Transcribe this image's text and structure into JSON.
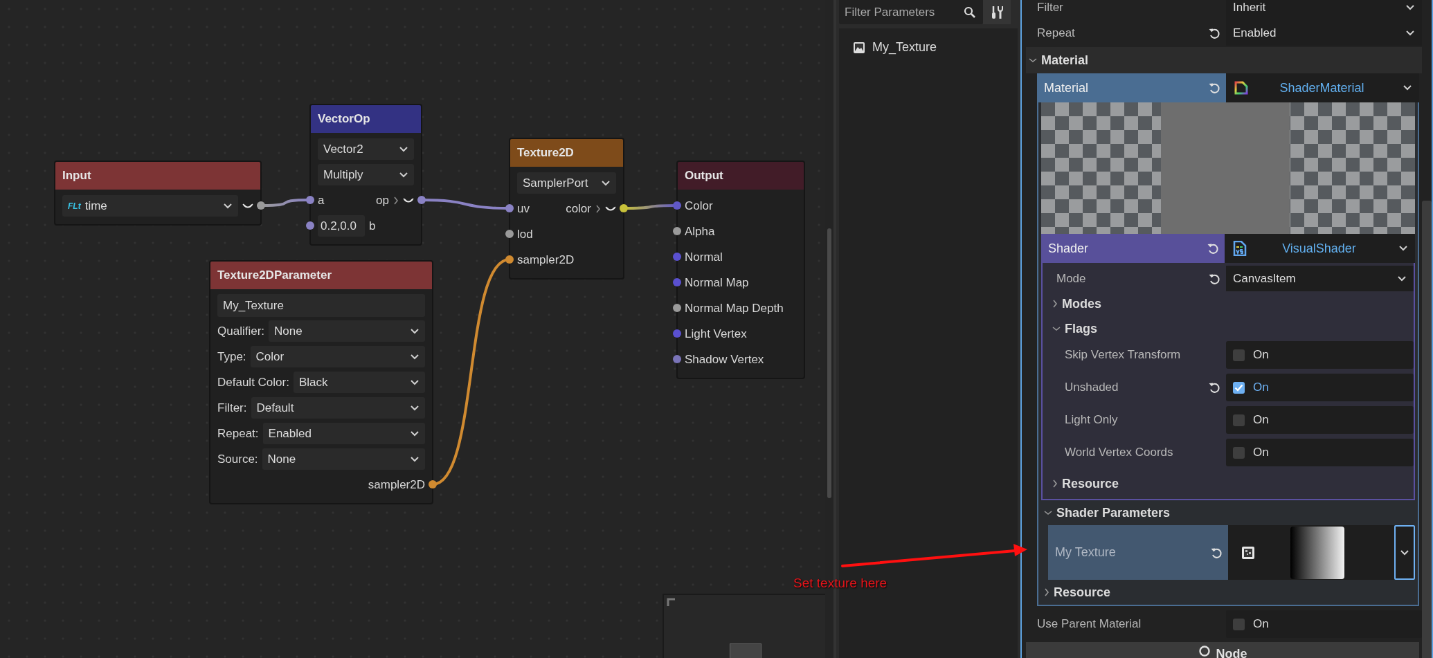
{
  "graph": {
    "nodes": [
      {
        "title": "Input",
        "color": "#7d3435",
        "rows": [
          {
            "kind": "select",
            "tag": "FLt",
            "value": "time",
            "preview": true,
            "out": {
              "color": "#9a9a9a"
            }
          }
        ]
      },
      {
        "title": "VectorOp",
        "color": "#333283",
        "rows": [
          {
            "kind": "select",
            "value": "Vector2"
          },
          {
            "kind": "select",
            "value": "Multiply"
          },
          {
            "kind": "port",
            "in": {
              "label": "a",
              "color": "#8a82c4"
            },
            "out": {
              "label": "op",
              "color": "#8a82c4"
            },
            "preview": true
          },
          {
            "kind": "port",
            "in": {
              "label": "b",
              "color": "#8a82c4"
            },
            "field": "0.2,0.0"
          }
        ]
      },
      {
        "title": "Texture2D",
        "color": "#7e4b1a",
        "rows": [
          {
            "kind": "select",
            "value": "SamplerPort"
          },
          {
            "kind": "port",
            "in": {
              "label": "uv",
              "color": "#8a82c4"
            },
            "out": {
              "label": "color",
              "color": "#c9c23a"
            },
            "preview": true
          },
          {
            "kind": "port",
            "in": {
              "label": "lod",
              "color": "#9a9a9a"
            }
          },
          {
            "kind": "port",
            "in": {
              "label": "sampler2D",
              "color": "#d08a30"
            }
          }
        ]
      },
      {
        "title": "Output",
        "color": "#421c28",
        "rows": [
          {
            "kind": "port",
            "in": {
              "label": "Color",
              "color": "#6058c8"
            }
          },
          {
            "kind": "port",
            "in": {
              "label": "Alpha",
              "color": "#9a9a9a"
            }
          },
          {
            "kind": "port",
            "in": {
              "label": "Normal",
              "color": "#5a50d0"
            }
          },
          {
            "kind": "port",
            "in": {
              "label": "Normal Map",
              "color": "#5a50d0"
            }
          },
          {
            "kind": "port",
            "in": {
              "label": "Normal Map Depth",
              "color": "#9a9a9a"
            }
          },
          {
            "kind": "port",
            "in": {
              "label": "Light Vertex",
              "color": "#5a50d0"
            }
          },
          {
            "kind": "port",
            "in": {
              "label": "Shadow Vertex",
              "color": "#7a74b8"
            }
          }
        ]
      },
      {
        "title": "Texture2DParameter",
        "color": "#7d3435",
        "rows": [
          {
            "kind": "text",
            "value": "My_Texture"
          },
          {
            "kind": "select",
            "label": "Qualifier:",
            "value": "None"
          },
          {
            "kind": "select",
            "label": "Type:",
            "value": "Color"
          },
          {
            "kind": "select",
            "label": "Default Color:",
            "value": "Black"
          },
          {
            "kind": "select",
            "label": "Filter:",
            "value": "Default"
          },
          {
            "kind": "select",
            "label": "Repeat:",
            "value": "Enabled"
          },
          {
            "kind": "select",
            "label": "Source:",
            "value": "None"
          },
          {
            "kind": "port",
            "out": {
              "label": "sampler2D",
              "color": "#d08a30"
            }
          }
        ]
      }
    ]
  },
  "parameters_panel": {
    "filter": {
      "placeholder": "Filter Parameters"
    },
    "items": [
      {
        "label": "My_Texture"
      }
    ]
  },
  "annotation": {
    "text": "Set texture here"
  },
  "inspector": {
    "properties": [
      {
        "label": "Filter",
        "value": "Inherit",
        "revert": false
      },
      {
        "label": "Repeat",
        "value": "Enabled",
        "revert": true
      }
    ],
    "section": {
      "label": "Material",
      "expanded": true
    },
    "material": {
      "label": "Material",
      "value": "ShaderMaterial",
      "revert": true
    },
    "shader": {
      "label": "Shader",
      "value": "VisualShader",
      "revert": true
    },
    "shader_properties": [
      {
        "kind": "select",
        "label": "Mode",
        "value": "CanvasItem",
        "revert": true
      },
      {
        "kind": "group",
        "label": "Modes",
        "expanded": false
      },
      {
        "kind": "group",
        "label": "Flags",
        "expanded": true,
        "children": [
          {
            "kind": "check",
            "label": "Skip Vertex Transform",
            "text": "On",
            "checked": false,
            "revert": false
          },
          {
            "kind": "check",
            "label": "Unshaded",
            "text": "On",
            "checked": true,
            "revert": true
          },
          {
            "kind": "check",
            "label": "Light Only",
            "text": "On",
            "checked": false,
            "revert": false
          },
          {
            "kind": "check",
            "label": "World Vertex Coords",
            "text": "On",
            "checked": false,
            "revert": false
          }
        ]
      },
      {
        "kind": "group",
        "label": "Resource",
        "expanded": false
      }
    ],
    "shader_parameters": {
      "label": "Shader Parameters",
      "expanded": true
    },
    "parameters": [
      {
        "label": "My Texture",
        "revert": true
      }
    ],
    "material_groups": [
      {
        "label": "Resource",
        "expanded": false
      }
    ],
    "after": [
      {
        "kind": "check",
        "label": "Use Parent Material",
        "text": "On",
        "checked": false,
        "revert": false
      }
    ],
    "node_button": "Node"
  }
}
